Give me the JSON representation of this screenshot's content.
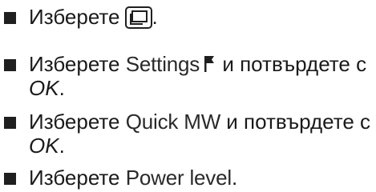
{
  "steps": [
    {
      "prefix": "Изберете",
      "suffix": ".",
      "icon": "window-stack-icon"
    },
    {
      "prefix": "Изберете",
      "ui_term": "Settings",
      "icon": "flag-icon",
      "middle": "и потвърдете с",
      "emphasis": "OK",
      "end": "."
    },
    {
      "prefix": "Изберете",
      "ui_term": "Quick MW",
      "middle": "и потвърдете с",
      "emphasis": "OK",
      "end": "."
    },
    {
      "prefix": "Изберете",
      "ui_term": "Power level",
      "end": "."
    }
  ]
}
